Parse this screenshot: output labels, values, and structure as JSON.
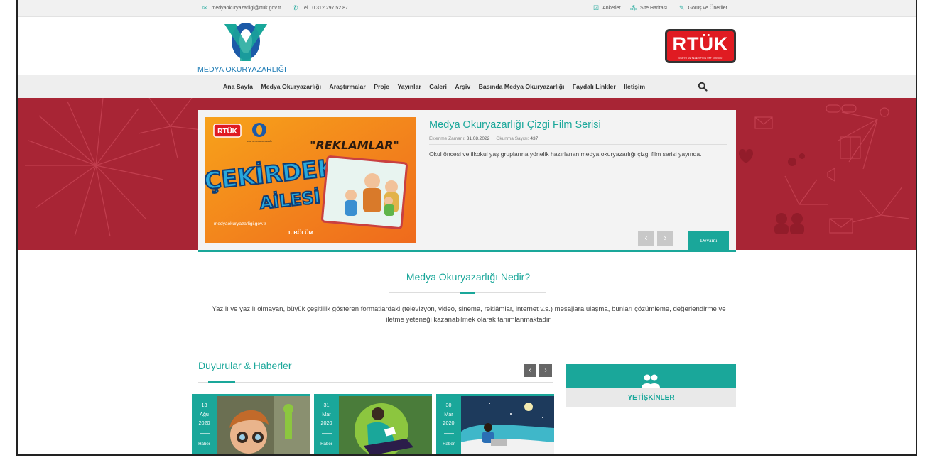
{
  "topbar": {
    "email": "medyaokuryazarligi@rtuk.gov.tr",
    "phone": "Tel : 0 312 297 52 87",
    "surveys": "Anketler",
    "sitemap": "Site Haritası",
    "feedback": "Görüş ve Öneriler"
  },
  "header": {
    "logo_caption": "MEDYA OKURYAZARLIĞI",
    "rtuk_logo": "RTÜK",
    "rtuk_sub": "RADYO VE TELEVİZYON ÜST KURULU"
  },
  "nav": {
    "items": [
      "Ana Sayfa",
      "Medya Okuryazarlığı",
      "Araştırmalar",
      "Proje",
      "Yayınlar",
      "Galeri",
      "Arşiv",
      "Basında Medya Okuryazarlığı",
      "Faydalı Linkler",
      "İletişim"
    ]
  },
  "slider": {
    "title": "Medya Okuryazarlığı Çizgi Film Serisi",
    "updated_label": "Eklenme Zamanı:",
    "updated_value": "31.08.2022",
    "reads_label": "Okunma Sayısı:",
    "reads_value": "437",
    "description": "Okul öncesi ve ilkokul yaş gruplarına yönelik hazırlanan medya okuryazarlığı çizgi film serisi yayında.",
    "more": "Devamı",
    "image": {
      "badge": "RTÜK",
      "small_caption": "MEDYA OKURYAZARLIĞI",
      "quote": "\"REKLAMLAR\"",
      "headline_1": "ÇEKİRDEK",
      "headline_2": "AİLESİ",
      "site": "medyaokuryazarligi.gov.tr",
      "episode": "1. BÖLÜM"
    }
  },
  "intro": {
    "title": "Medya Okuryazarlığı Nedir?",
    "text": "Yazılı ve yazılı olmayan, büyük çeşitlilik gösteren formatlardaki (televizyon, video, sinema, reklâmlar, internet v.s.) mesajlara ulaşma, bunları çözümleme, değerlendirme ve iletme yeteneği kazanabilmek olarak tanımlanmaktadır."
  },
  "news": {
    "title": "Duyurular & Haberler",
    "cards": [
      {
        "day": "13",
        "month": "Ağu",
        "year": "2020",
        "category": "Haber"
      },
      {
        "day": "31",
        "month": "Mar",
        "year": "2020",
        "category": "Haber"
      },
      {
        "day": "30",
        "month": "Mar",
        "year": "2020",
        "category": "Haber"
      }
    ]
  },
  "audience": {
    "label": "YETİŞKİNLER"
  },
  "colors": {
    "accent": "#1aa79a",
    "hero_bg": "#a82535",
    "rtuk_red": "#e01b22"
  }
}
